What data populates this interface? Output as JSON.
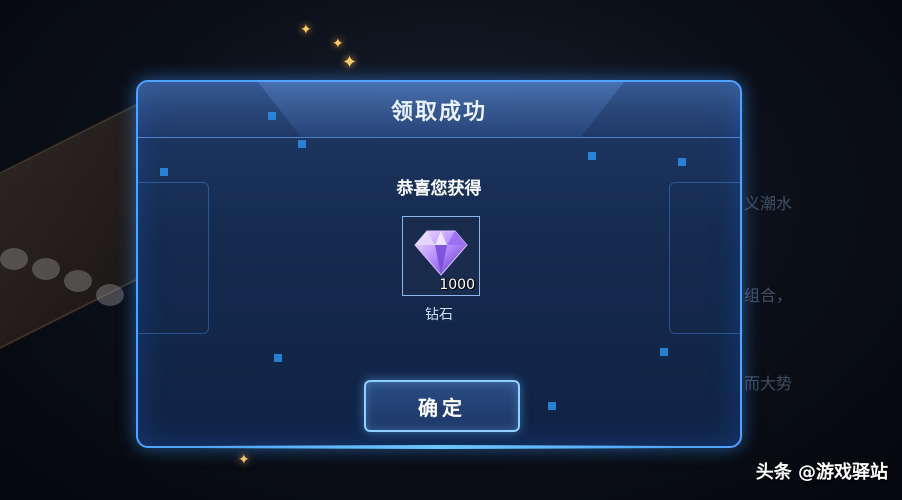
{
  "dialog": {
    "title": "领取成功",
    "subtitle": "恭喜您获得",
    "reward": {
      "icon": "diamond-icon",
      "count": "1000",
      "name": "钻石"
    },
    "confirm_label": "确定"
  },
  "background_text": [
    "义潮水",
    "组合，",
    "而大势"
  ],
  "watermark": "头条 @游戏驿站",
  "colors": {
    "accent": "#4fa3ff",
    "gem": "#a77bff"
  }
}
